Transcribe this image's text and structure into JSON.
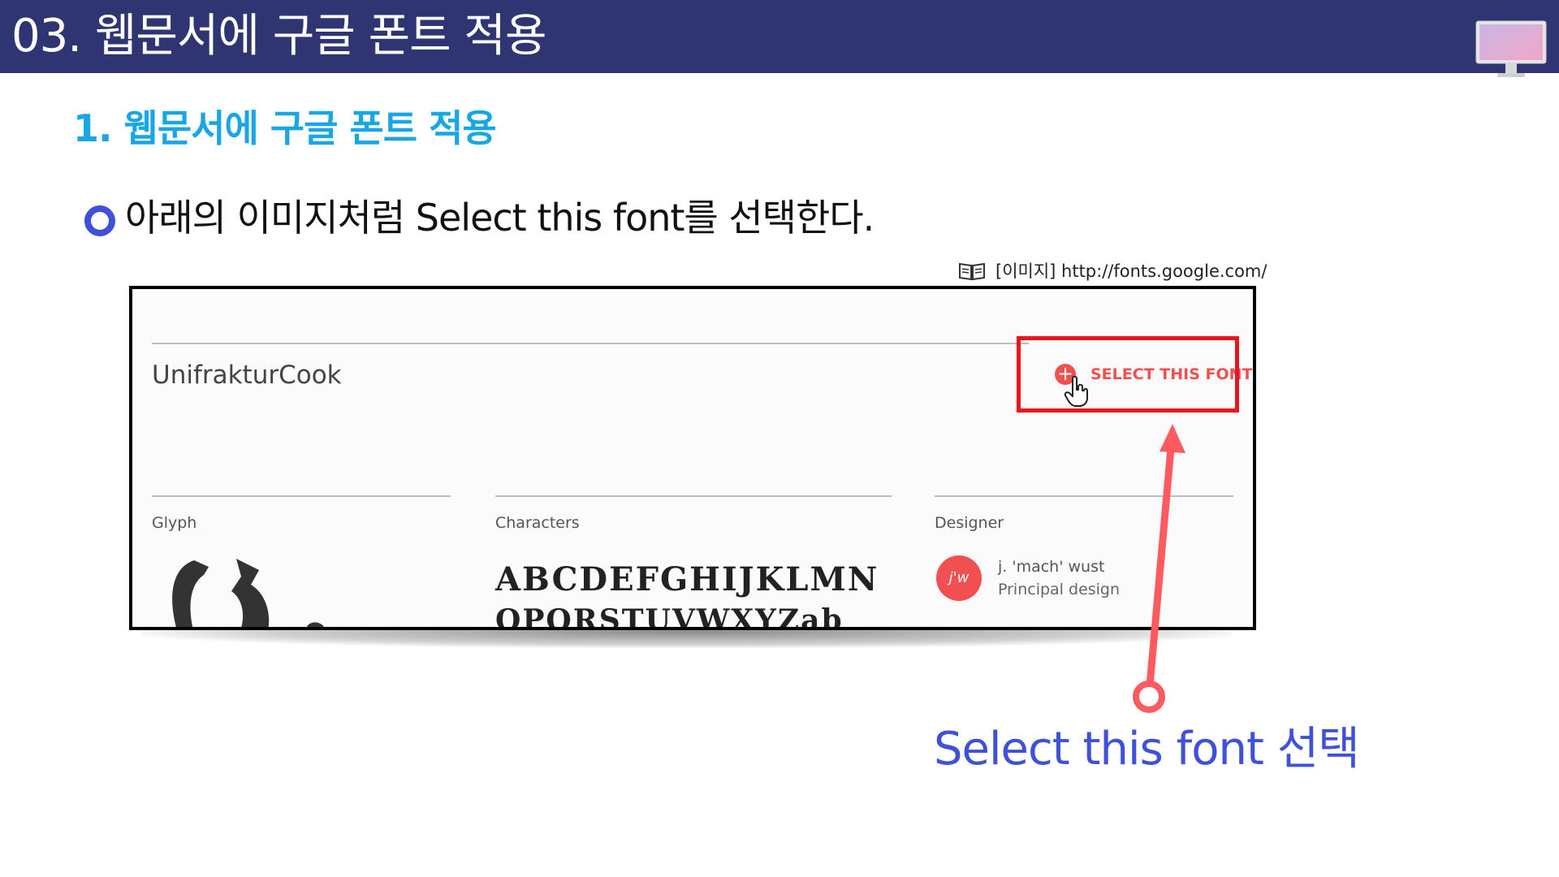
{
  "header": {
    "title": "03. 웹문서에 구글 폰트 적용",
    "icon": "monitor-icon",
    "background": "#2e3572"
  },
  "section": {
    "title": "1. 웹문서에 구글 폰트 적용",
    "color": "#1aa6e4"
  },
  "bullet": {
    "text": "아래의 이미지처럼 Select this font를 선택한다."
  },
  "source": {
    "icon": "book-icon",
    "text": "[이미지] http://fonts.google.com/"
  },
  "screenshot": {
    "font_name": "UnifrakturCook",
    "select_button_label": "SELECT THIS FONT",
    "select_button_color": "#f05050",
    "columns": {
      "glyph_label": "Glyph",
      "characters_label": "Characters",
      "designer_label": "Designer"
    },
    "characters_row1": "ABCDEFGHIJKLMN",
    "characters_row2": "OPQRSTUVWXYZab",
    "designer": {
      "avatar_initials": "j'w",
      "name": "j. 'mach' wust",
      "role": "Principal design"
    }
  },
  "annotation": {
    "highlight_color": "#e8141e",
    "arrow_color": "#ff5a5f",
    "callout_text": "Select this font 선택",
    "callout_color": "#3f51d8"
  }
}
